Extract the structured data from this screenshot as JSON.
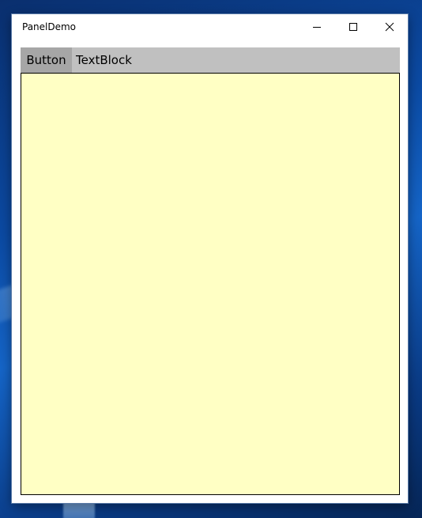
{
  "window": {
    "title": "PanelDemo",
    "controls": {
      "minimize_icon": "minimize-icon",
      "maximize_icon": "maximize-icon",
      "close_icon": "close-icon"
    }
  },
  "content": {
    "button_label": "Button",
    "textblock_text": "TextBlock",
    "colors": {
      "toolbar_bg": "#c0c0c0",
      "button_bg": "#a6a6a6",
      "panel_bg": "#ffffc4",
      "panel_border": "#000000"
    }
  }
}
